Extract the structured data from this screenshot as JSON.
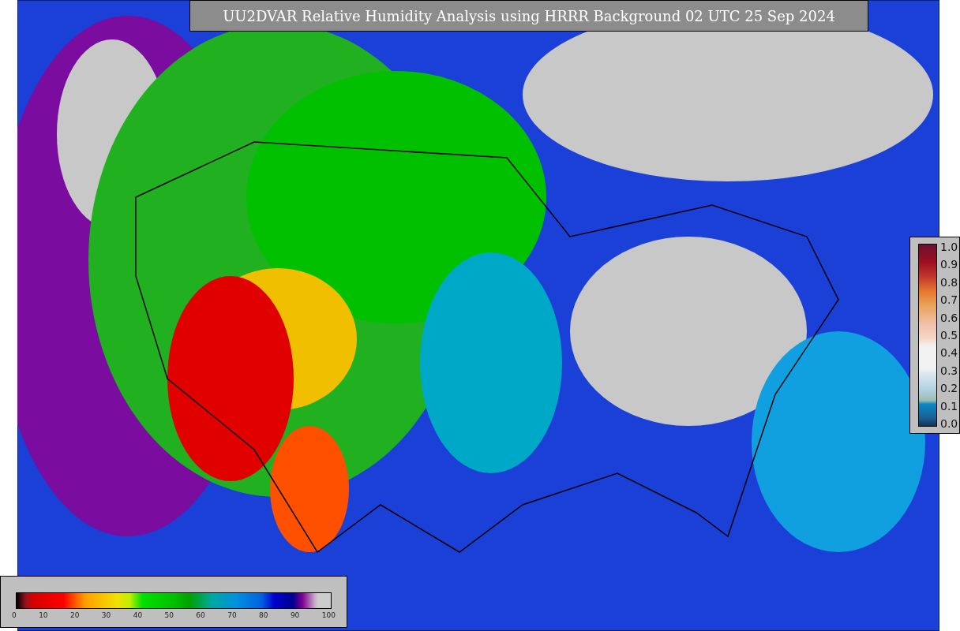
{
  "title": "UU2DVAR Relative Humidity Analysis using HRRR Background 02 UTC 25 Sep 2024",
  "station_legend": {
    "ticks": [
      "1.0",
      "0.9",
      "0.8",
      "0.7",
      "0.6",
      "0.5",
      "0.4",
      "0.3",
      "0.2",
      "0.1",
      "0.0"
    ]
  },
  "humidity_legend": {
    "ticks": [
      "0",
      "10",
      "20",
      "30",
      "40",
      "50",
      "60",
      "70",
      "80",
      "90",
      "100"
    ]
  }
}
